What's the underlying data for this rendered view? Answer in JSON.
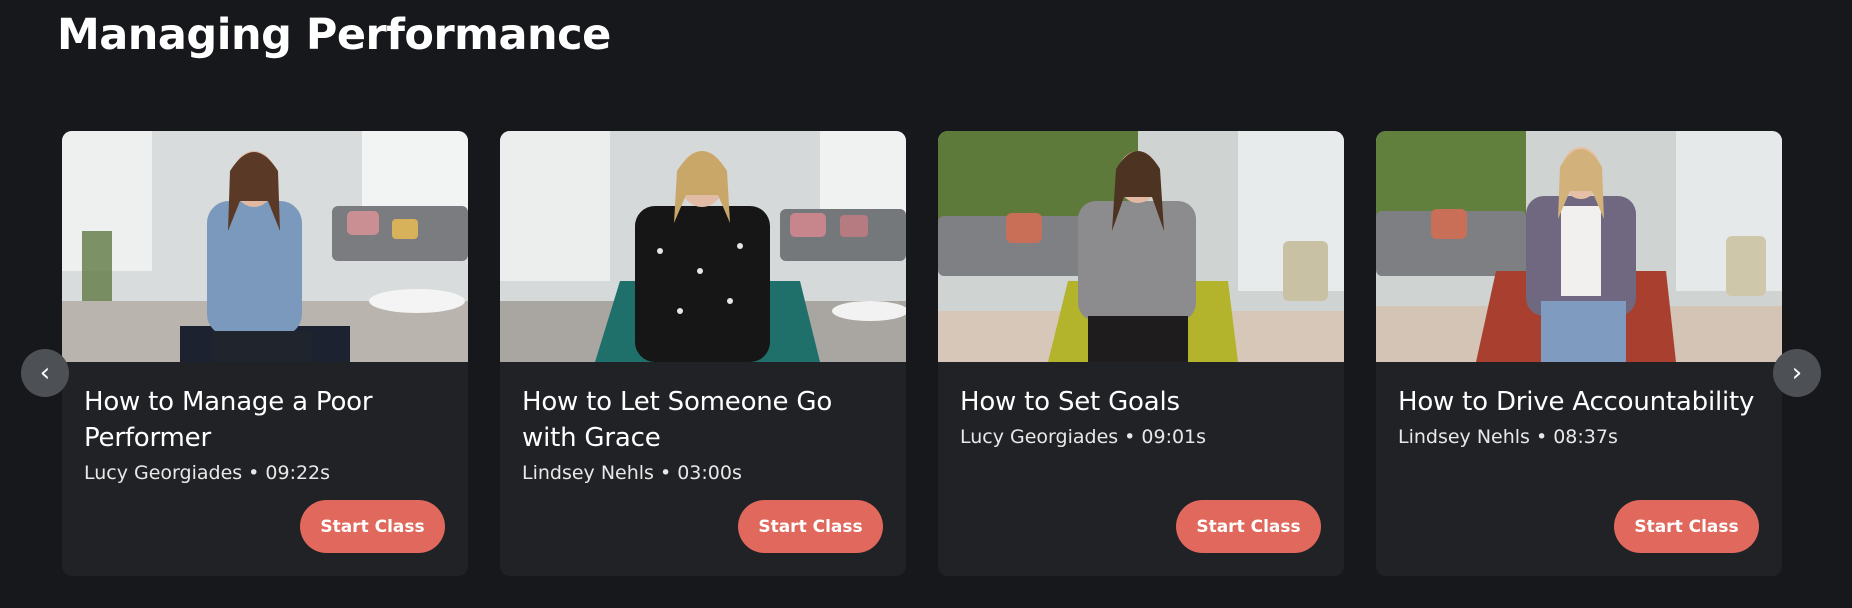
{
  "section": {
    "title": "Managing Performance"
  },
  "carousel": {
    "prev_icon": "‹",
    "next_icon": "›",
    "cards": [
      {
        "title": "How to Manage a Poor Performer",
        "instructor": "Lucy Georgiades",
        "duration": "09:22s",
        "button_label": "Start Class",
        "separator": "•"
      },
      {
        "title": "How to Let Someone Go with Grace",
        "instructor": "Lindsey Nehls",
        "duration": "03:00s",
        "button_label": "Start Class",
        "separator": "•"
      },
      {
        "title": "How to Set Goals",
        "instructor": "Lucy Georgiades",
        "duration": "09:01s",
        "button_label": "Start Class",
        "separator": "•"
      },
      {
        "title": "How to Drive Accountability",
        "instructor": "Lindsey Nehls",
        "duration": "08:37s",
        "button_label": "Start Class",
        "separator": "•"
      }
    ]
  },
  "colors": {
    "background": "#17181c",
    "card": "#202226",
    "button": "#e0685c",
    "arrow": "#4d5055"
  }
}
